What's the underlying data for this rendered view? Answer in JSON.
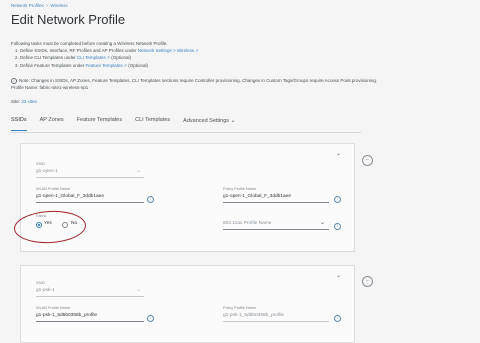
{
  "breadcrumb": [
    "Network Profiles",
    "Wireless"
  ],
  "page_title": "Edit Network Profile",
  "intro": {
    "lead": "Following tasks must be completed before creating a Wireless Network Profile.",
    "step1_prefix": "1. Define SSIDs, Interface, RF Profiles and AP Profiles under",
    "step1_link": "Network Settings > Wireless",
    "step2_prefix": "2. Define CLI Templates under",
    "step2_link": "CLI Templates",
    "step2_suffix": "(Optional)",
    "step3_prefix": "3. Define Feature Templates under",
    "step3_link": "Feature Templates",
    "step3_suffix": "(Optional)"
  },
  "note": {
    "text": "Note: Changes in SSIDs, AP Zones, Feature Templates, CLI Templates sections require Controller provisioning. Changes in Custom Tags/Groups require Access Point provisioning.",
    "profile_name_label": "Profile Name:",
    "profile_name_value": "fabric-site1-wireless-np1"
  },
  "site": {
    "label": "Site:",
    "link": "33 sites"
  },
  "tabs": [
    "SSIDs",
    "AP Zones",
    "Feature Templates",
    "CLI Templates",
    "Advanced Settings"
  ],
  "ssid_cards": [
    {
      "ssid_label": "SSID",
      "ssid_value": "g1-open-1",
      "wlan_label": "WLAN Profile Name",
      "wlan_value": "g1-open-1_Global_F_3ddb1aee",
      "policy_label": "Policy Profile Name",
      "policy_value": "g1-open-1_Global_F_3ddb1aee",
      "fabric_label": "Fabric",
      "yes": "Yes",
      "no": "No",
      "yes_selected": true,
      "ap802_placeholder": "802.11ax Profile Name"
    },
    {
      "ssid_label": "SSID",
      "ssid_value": "g1-psk-1",
      "wlan_label": "WLAN Profile Name",
      "wlan_value": "g1-psk-1_5d5b0358b_profile",
      "policy_label": "Policy Profile Name",
      "policy_value": "g1-psk-1_5d5b0358b_profile"
    }
  ],
  "colors": {
    "accent": "#3d7fc2",
    "annotation": "#a4242c"
  },
  "icons": [
    "external-link-icon",
    "info-icon",
    "chevron-down-icon",
    "delete-icon"
  ]
}
